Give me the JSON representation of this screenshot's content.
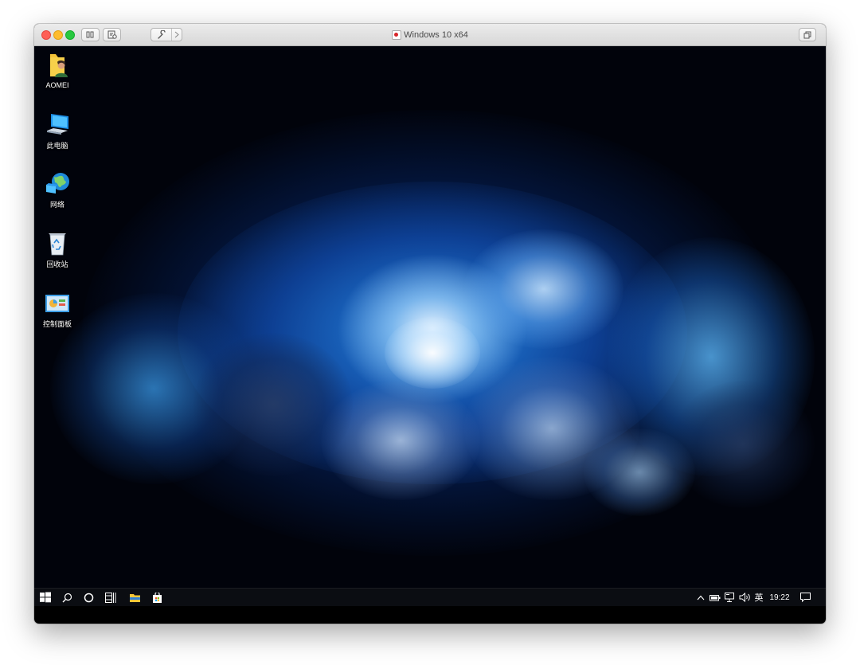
{
  "window": {
    "title": "Windows 10 x64",
    "titlebar_buttons": [
      "pause-resume",
      "snapshots",
      "settings",
      "forward",
      "restore-size"
    ]
  },
  "desktop": {
    "icons": [
      {
        "label": "AOMEI",
        "icon": "folder-user-icon"
      },
      {
        "label": "此电脑",
        "icon": "computer-icon"
      },
      {
        "label": "网络",
        "icon": "network-icon"
      },
      {
        "label": "回收站",
        "icon": "recycle-bin-icon"
      },
      {
        "label": "控制面板",
        "icon": "control-panel-icon"
      }
    ]
  },
  "taskbar": {
    "left_items": [
      "start-icon",
      "search-icon",
      "cortana-icon",
      "task-view-icon",
      "file-explorer-icon",
      "store-icon"
    ],
    "tray": {
      "input_method": "英",
      "time": "19:22",
      "icons": [
        "chevron-up-icon",
        "battery-icon",
        "network-icon",
        "volume-icon",
        "notification-icon"
      ]
    }
  },
  "colors": {
    "accent_blue": "#3fa4ff",
    "taskbar": "#0b0d12",
    "titlebar": "#e4e4e4"
  }
}
